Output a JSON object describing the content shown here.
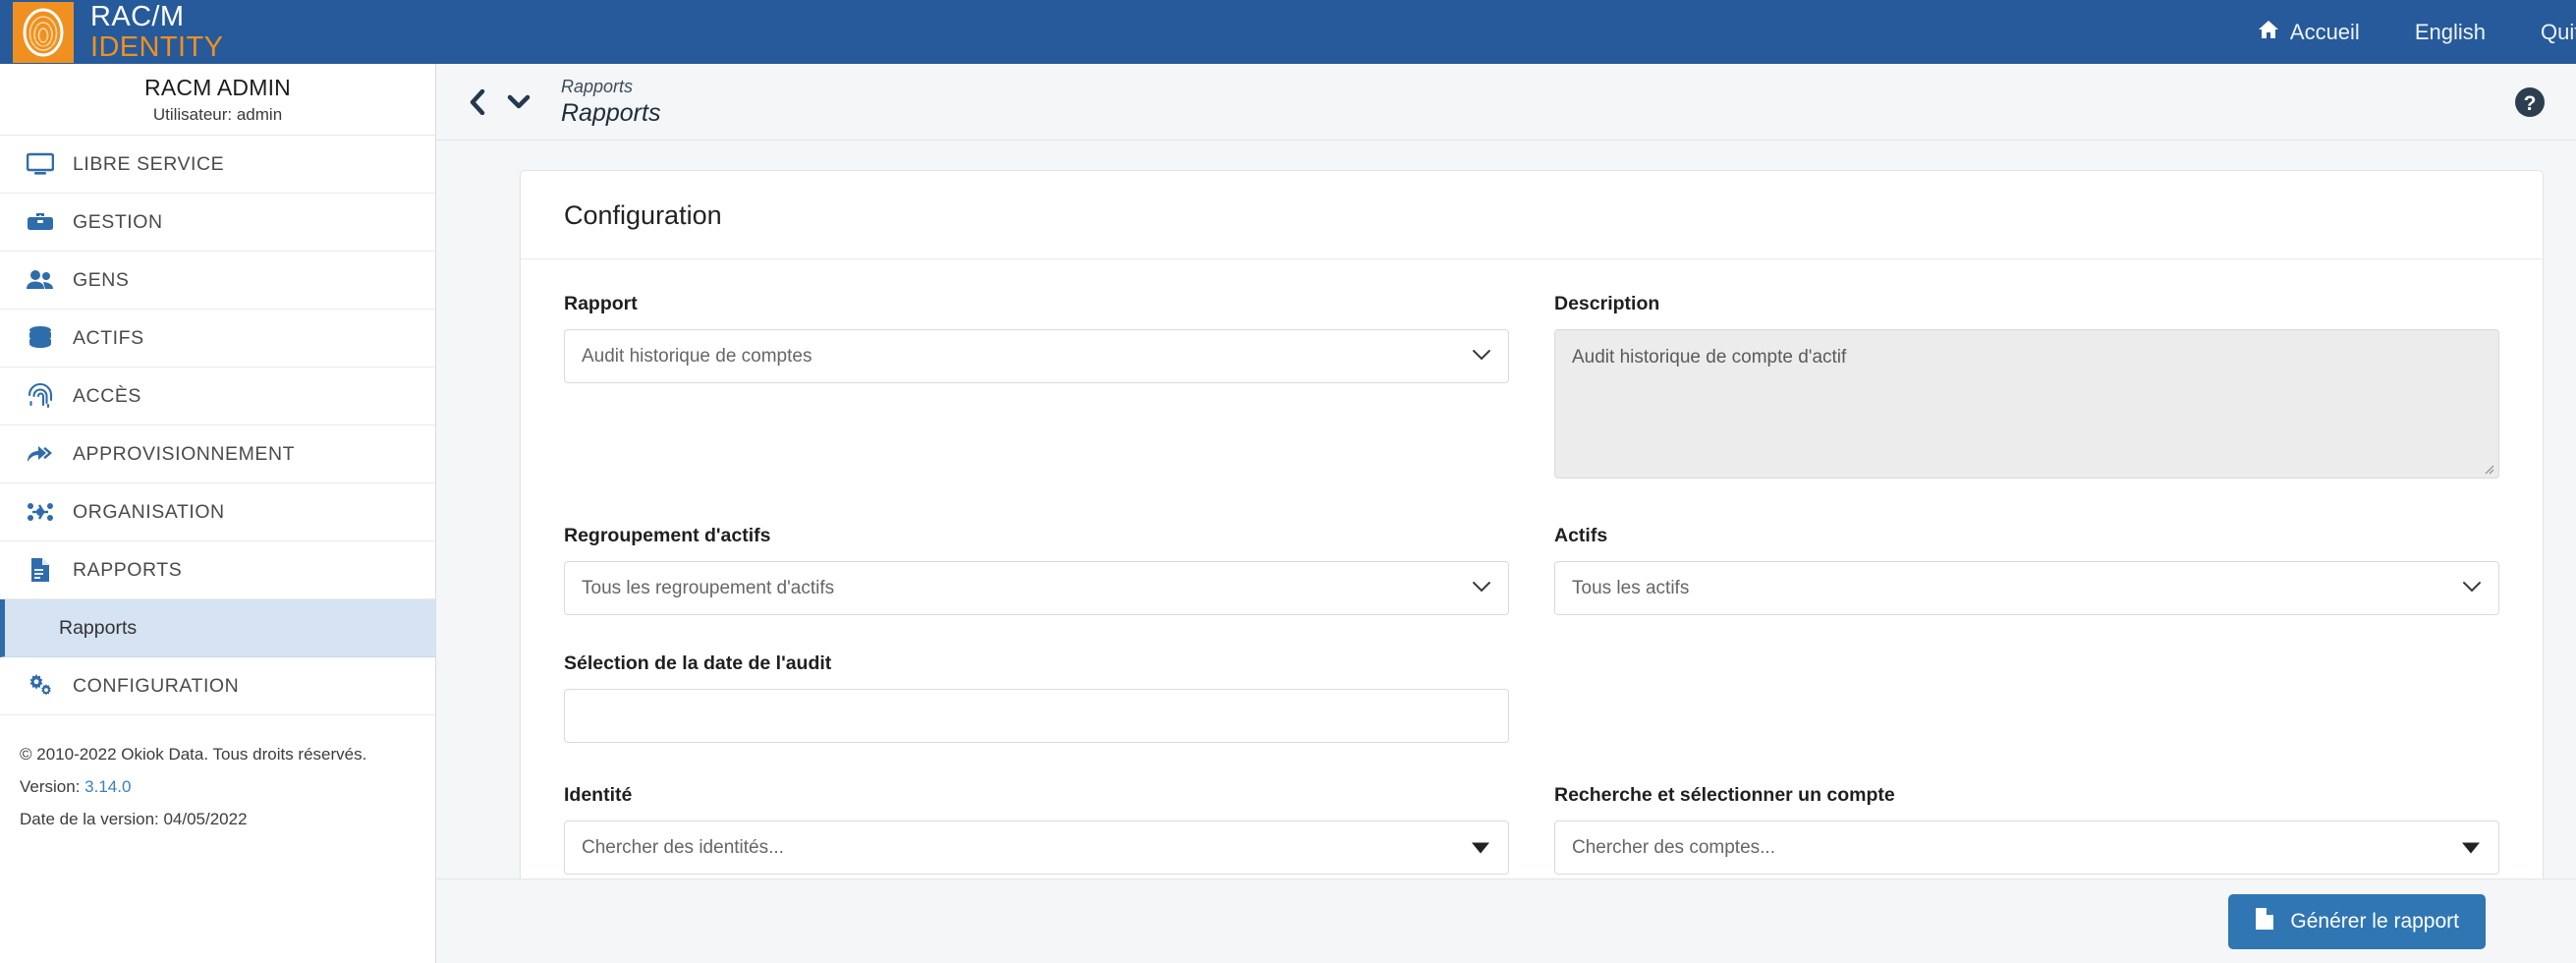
{
  "brand": {
    "logo_line1": "RAC/M",
    "logo_line2": "IDENTITY",
    "logo_icon": "fingerprint-icon",
    "accent_orange": "#f09020",
    "header_blue": "#265a9a",
    "link_blue": "#3a7fc1"
  },
  "topnav": {
    "home_icon": "home-icon",
    "items": [
      {
        "label": "Accueil"
      },
      {
        "label": "English"
      },
      {
        "label": "Quitter"
      }
    ]
  },
  "sidebar": {
    "user": {
      "name": "RACM ADMIN",
      "sub": "Utilisateur: admin"
    },
    "items": [
      {
        "label": "LIBRE SERVICE",
        "icon": "monitor-icon"
      },
      {
        "label": "GESTION",
        "icon": "toolbox-icon"
      },
      {
        "label": "GENS",
        "icon": "users-icon"
      },
      {
        "label": "ACTIFS",
        "icon": "database-icon"
      },
      {
        "label": "ACCÈS",
        "icon": "fingerprint-icon"
      },
      {
        "label": "APPROVISIONNEMENT",
        "icon": "share-arrow-icon"
      },
      {
        "label": "ORGANISATION",
        "icon": "sitemap-icon"
      },
      {
        "label": "RAPPORTS",
        "icon": "document-icon"
      }
    ],
    "active_sub": {
      "label": "Rapports"
    },
    "config_item": {
      "label": "CONFIGURATION",
      "icon": "gears-icon"
    },
    "footer": {
      "copyright": "© 2010-2022 Okiok Data. Tous droits réservés.",
      "version_label": "Version:",
      "version_value": "3.14.0",
      "release_date": "Date de la version: 04/05/2022"
    }
  },
  "breadcrumb": {
    "back_icon": "chevron-left-icon",
    "dropdown_icon": "chevron-down-icon",
    "parent": "Rapports",
    "current": "Rapports",
    "help_icon": "help-circle-icon"
  },
  "card": {
    "title": "Configuration",
    "fields": {
      "rapport": {
        "label": "Rapport",
        "value": "Audit historique de comptes",
        "caret": "chevron-down-icon"
      },
      "description": {
        "label": "Description",
        "value": "Audit historique de compte d'actif",
        "resize_handle": "resize-grip-icon"
      },
      "regroupement": {
        "label": "Regroupement d'actifs",
        "value": "Tous les regroupement d'actifs",
        "caret": "chevron-down-icon"
      },
      "actifs": {
        "label": "Actifs",
        "value": "Tous les actifs",
        "caret": "chevron-down-icon"
      },
      "date_audit": {
        "label": "Sélection de la date de l'audit",
        "value": "",
        "placeholder": ""
      },
      "identite": {
        "label": "Identité",
        "placeholder": "Chercher des identités...",
        "caret": "triangle-down-icon"
      },
      "compte": {
        "label": "Recherche et sélectionner un compte",
        "placeholder": "Chercher des comptes...",
        "caret": "triangle-down-icon"
      }
    }
  },
  "actionbar": {
    "generate_label": "Générer le rapport",
    "generate_icon": "document-icon"
  }
}
